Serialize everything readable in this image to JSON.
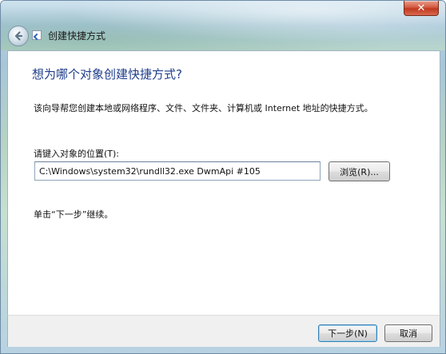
{
  "window": {
    "title": "创建快捷方式",
    "close_glyph": "✕"
  },
  "icons": {
    "back": "back-arrow-icon",
    "title": "shortcut-icon",
    "close": "close-icon"
  },
  "content": {
    "heading": "想为哪个对象创建快捷方式?",
    "description": "该向导帮您创建本地或网络程序、文件、文件夹、计算机或 Internet 地址的快捷方式。",
    "location_label": "请键入对象的位置(T):",
    "location_value": "C:\\Windows\\system32\\rundll32.exe DwmApi #105",
    "browse_label": "浏览(R)...",
    "continue_text": "单击“下一步”继续。"
  },
  "footer": {
    "next_label": "下一步(N)",
    "cancel_label": "取消"
  },
  "colors": {
    "heading": "#1f3d8a",
    "close_button": "#c0391f",
    "default_button_border": "#3c7fb1"
  }
}
